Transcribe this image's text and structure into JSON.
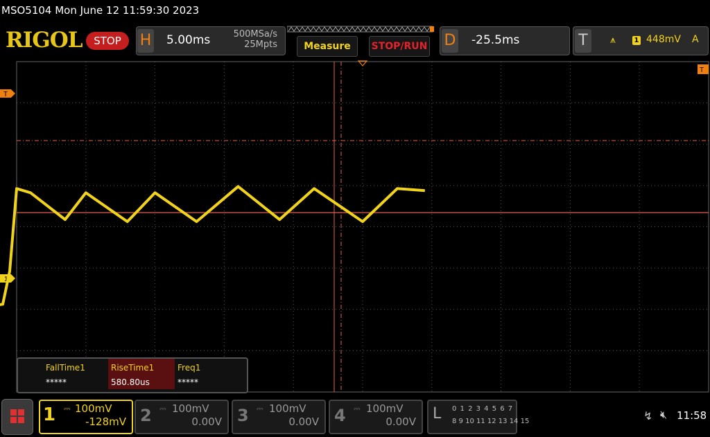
{
  "titlebar": {
    "title": "MSO5104  Mon June 12 11:59:30 2023"
  },
  "brand": {
    "name": "RIGOL",
    "status": "STOP"
  },
  "horizontal": {
    "letter": "H",
    "timebase": "5.00ms",
    "sample_rate": "500MSa/s",
    "memory_depth": "25Mpts"
  },
  "buttons": {
    "measure": "Measure",
    "stop_run": "STOP/RUN"
  },
  "delay": {
    "letter": "D",
    "value": "-25.5ms"
  },
  "trigger": {
    "letter": "T",
    "edge_icon": "rising-edge-icon",
    "source": "1",
    "level": "448mV",
    "mode": "A"
  },
  "markers": {
    "trigger_marker": "T",
    "ch1_marker": "1",
    "right_marker": "T"
  },
  "measurements": [
    {
      "name": "FallTime1",
      "value": "*****"
    },
    {
      "name": "RiseTime1",
      "value": "580.80us"
    },
    {
      "name": "Freq1",
      "value": "*****"
    }
  ],
  "channels": [
    {
      "num": "1",
      "scale": "100mV",
      "offset": "-128mV",
      "active": true
    },
    {
      "num": "2",
      "scale": "100mV",
      "offset": "0.00V",
      "active": false
    },
    {
      "num": "3",
      "scale": "100mV",
      "offset": "0.00V",
      "active": false
    },
    {
      "num": "4",
      "scale": "100mV",
      "offset": "0.00V",
      "active": false
    }
  ],
  "logic": {
    "letter": "L",
    "row1": "0 1 2 3  4 5 6 7",
    "row2": "8 9 10 11 12 13 14 15"
  },
  "statusbar": {
    "usb_icon": "usb-icon",
    "speaker_icon": "speaker-muted-icon",
    "time": "11:58"
  },
  "colors": {
    "ch1": "#f2d31b",
    "accent": "#f08010",
    "stop": "#c41e1e"
  },
  "chart_data": {
    "type": "line",
    "series": [
      {
        "name": "1",
        "x_ms": [
          -47.5,
          -43.0,
          -40.0,
          -38.5,
          -33.0,
          -30.5,
          -26.0,
          -25.5,
          -25.0,
          -24.0,
          -21.5,
          -20.0,
          -17.0,
          -15.0,
          -12.0,
          -9.0,
          -6.0,
          -3.5,
          0.0,
          2.5,
          4.5
        ],
        "y_mV": [
          -200,
          -218,
          -200,
          -220,
          -200,
          -222,
          -200,
          -120,
          80,
          70,
          5,
          70,
          0,
          70,
          0,
          85,
          5,
          80,
          0,
          80,
          75
        ]
      }
    ],
    "horizontal_scale": "5.00ms/div",
    "vertical_scale": "100mV/div",
    "trigger_level_mV": 448,
    "grid": true
  }
}
